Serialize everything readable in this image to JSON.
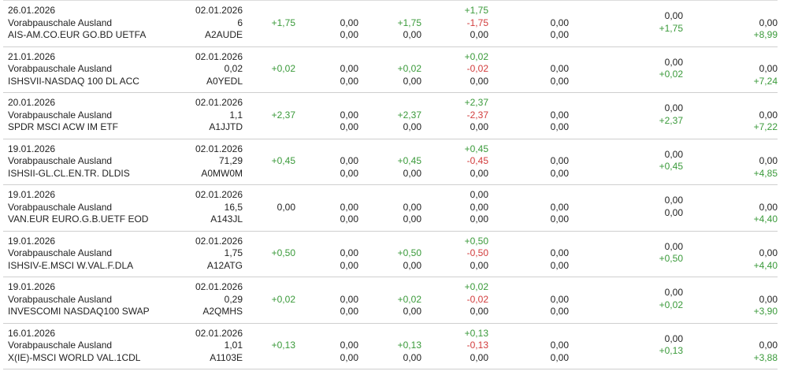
{
  "colors": {
    "positive": "#3a9a3a",
    "negative": "#d23c3c",
    "neutral": "#222222",
    "divider": "#cfcfcf"
  },
  "rows": [
    {
      "date": "26.01.2026",
      "type": "Vorabpauschale Ausland",
      "name": "AIS-AM.CO.EUR GO.BD UETFA",
      "date2": "02.01.2026",
      "quantity": "6",
      "wkn": "A2AUDE",
      "c3": "+1,75",
      "c4a": "0,00",
      "c4b": "0,00",
      "c5a": "+1,75",
      "c5b": "0,00",
      "c6a": "+1,75",
      "c6b": "-1,75",
      "c6c": "0,00",
      "c7a": "0,00",
      "c7b": "0,00",
      "c8a": "0,00",
      "c8b": "+1,75",
      "c9a": "0,00",
      "c9b": "+8,99"
    },
    {
      "date": "21.01.2026",
      "type": "Vorabpauschale Ausland",
      "name": "ISHSVII-NASDAQ 100 DL ACC",
      "date2": "02.01.2026",
      "quantity": "0,02",
      "wkn": "A0YEDL",
      "c3": "+0,02",
      "c4a": "0,00",
      "c4b": "0,00",
      "c5a": "+0,02",
      "c5b": "0,00",
      "c6a": "+0,02",
      "c6b": "-0,02",
      "c6c": "0,00",
      "c7a": "0,00",
      "c7b": "0,00",
      "c8a": "0,00",
      "c8b": "+0,02",
      "c9a": "0,00",
      "c9b": "+7,24"
    },
    {
      "date": "20.01.2026",
      "type": "Vorabpauschale Ausland",
      "name": "SPDR MSCI ACW IM ETF",
      "date2": "02.01.2026",
      "quantity": "1,1",
      "wkn": "A1JJTD",
      "c3": "+2,37",
      "c4a": "0,00",
      "c4b": "0,00",
      "c5a": "+2,37",
      "c5b": "0,00",
      "c6a": "+2,37",
      "c6b": "-2,37",
      "c6c": "0,00",
      "c7a": "0,00",
      "c7b": "0,00",
      "c8a": "0,00",
      "c8b": "+2,37",
      "c9a": "0,00",
      "c9b": "+7,22"
    },
    {
      "date": "19.01.2026",
      "type": "Vorabpauschale Ausland",
      "name": "ISHSII-GL.CL.EN.TR. DLDIS",
      "date2": "02.01.2026",
      "quantity": "71,29",
      "wkn": "A0MW0M",
      "c3": "+0,45",
      "c4a": "0,00",
      "c4b": "0,00",
      "c5a": "+0,45",
      "c5b": "0,00",
      "c6a": "+0,45",
      "c6b": "-0,45",
      "c6c": "0,00",
      "c7a": "0,00",
      "c7b": "0,00",
      "c8a": "0,00",
      "c8b": "+0,45",
      "c9a": "0,00",
      "c9b": "+4,85"
    },
    {
      "date": "19.01.2026",
      "type": "Vorabpauschale Ausland",
      "name": "VAN.EUR EURO.G.B.UETF EOD",
      "date2": "02.01.2026",
      "quantity": "16,5",
      "wkn": "A143JL",
      "c3": "0,00",
      "c4a": "0,00",
      "c4b": "0,00",
      "c5a": "0,00",
      "c5b": "0,00",
      "c6a": "0,00",
      "c6b": "0,00",
      "c6c": "0,00",
      "c7a": "0,00",
      "c7b": "0,00",
      "c8a": "0,00",
      "c8b": "0,00",
      "c9a": "0,00",
      "c9b": "+4,40"
    },
    {
      "date": "19.01.2026",
      "type": "Vorabpauschale Ausland",
      "name": "ISHSIV-E.MSCI W.VAL.F.DLA",
      "date2": "02.01.2026",
      "quantity": "1,75",
      "wkn": "A12ATG",
      "c3": "+0,50",
      "c4a": "0,00",
      "c4b": "0,00",
      "c5a": "+0,50",
      "c5b": "0,00",
      "c6a": "+0,50",
      "c6b": "-0,50",
      "c6c": "0,00",
      "c7a": "0,00",
      "c7b": "0,00",
      "c8a": "0,00",
      "c8b": "+0,50",
      "c9a": "0,00",
      "c9b": "+4,40"
    },
    {
      "date": "19.01.2026",
      "type": "Vorabpauschale Ausland",
      "name": "INVESCOMI NASDAQ100 SWAP",
      "date2": "02.01.2026",
      "quantity": "0,29",
      "wkn": "A2QMHS",
      "c3": "+0,02",
      "c4a": "0,00",
      "c4b": "0,00",
      "c5a": "+0,02",
      "c5b": "0,00",
      "c6a": "+0,02",
      "c6b": "-0,02",
      "c6c": "0,00",
      "c7a": "0,00",
      "c7b": "0,00",
      "c8a": "0,00",
      "c8b": "+0,02",
      "c9a": "0,00",
      "c9b": "+3,90"
    },
    {
      "date": "16.01.2026",
      "type": "Vorabpauschale Ausland",
      "name": "X(IE)-MSCI WORLD VAL.1CDL",
      "date2": "02.01.2026",
      "quantity": "1,01",
      "wkn": "A1103E",
      "c3": "+0,13",
      "c4a": "0,00",
      "c4b": "0,00",
      "c5a": "+0,13",
      "c5b": "0,00",
      "c6a": "+0,13",
      "c6b": "-0,13",
      "c6c": "0,00",
      "c7a": "0,00",
      "c7b": "0,00",
      "c8a": "0,00",
      "c8b": "+0,13",
      "c9a": "0,00",
      "c9b": "+3,88"
    }
  ]
}
